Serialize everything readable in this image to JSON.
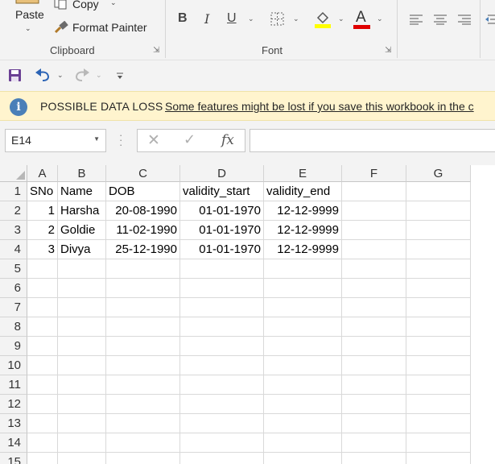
{
  "ribbon": {
    "clipboard": {
      "paste_label": "Paste",
      "copy_label": "Copy",
      "format_painter_label": "Format Painter",
      "group_label": "Clipboard"
    },
    "font": {
      "bold": "B",
      "italic": "I",
      "underline": "U",
      "font_color_glyph": "A",
      "group_label": "Font",
      "fill_color": "#ffff00",
      "font_color": "#e00000"
    }
  },
  "message_bar": {
    "title": "POSSIBLE DATA LOSS",
    "text": "Some features might be lost if you save this workbook in the c"
  },
  "formula_bar": {
    "name_box": "E14",
    "fx": "fx",
    "value": ""
  },
  "sheet": {
    "columns": [
      "A",
      "B",
      "C",
      "D",
      "E",
      "F",
      "G"
    ],
    "rows": [
      "1",
      "2",
      "3",
      "4",
      "5",
      "6",
      "7",
      "8",
      "9",
      "10",
      "11",
      "12",
      "13",
      "14",
      "15"
    ],
    "cells": [
      [
        "SNo",
        "Name",
        "DOB",
        "validity_start",
        "validity_end",
        "",
        ""
      ],
      [
        "1",
        "Harsha",
        "20-08-1990",
        "01-01-1970",
        "12-12-9999",
        "",
        ""
      ],
      [
        "2",
        "Goldie",
        "11-02-1990",
        "01-01-1970",
        "12-12-9999",
        "",
        ""
      ],
      [
        "3",
        "Divya",
        "25-12-1990",
        "01-01-1970",
        "12-12-9999",
        "",
        ""
      ]
    ]
  }
}
